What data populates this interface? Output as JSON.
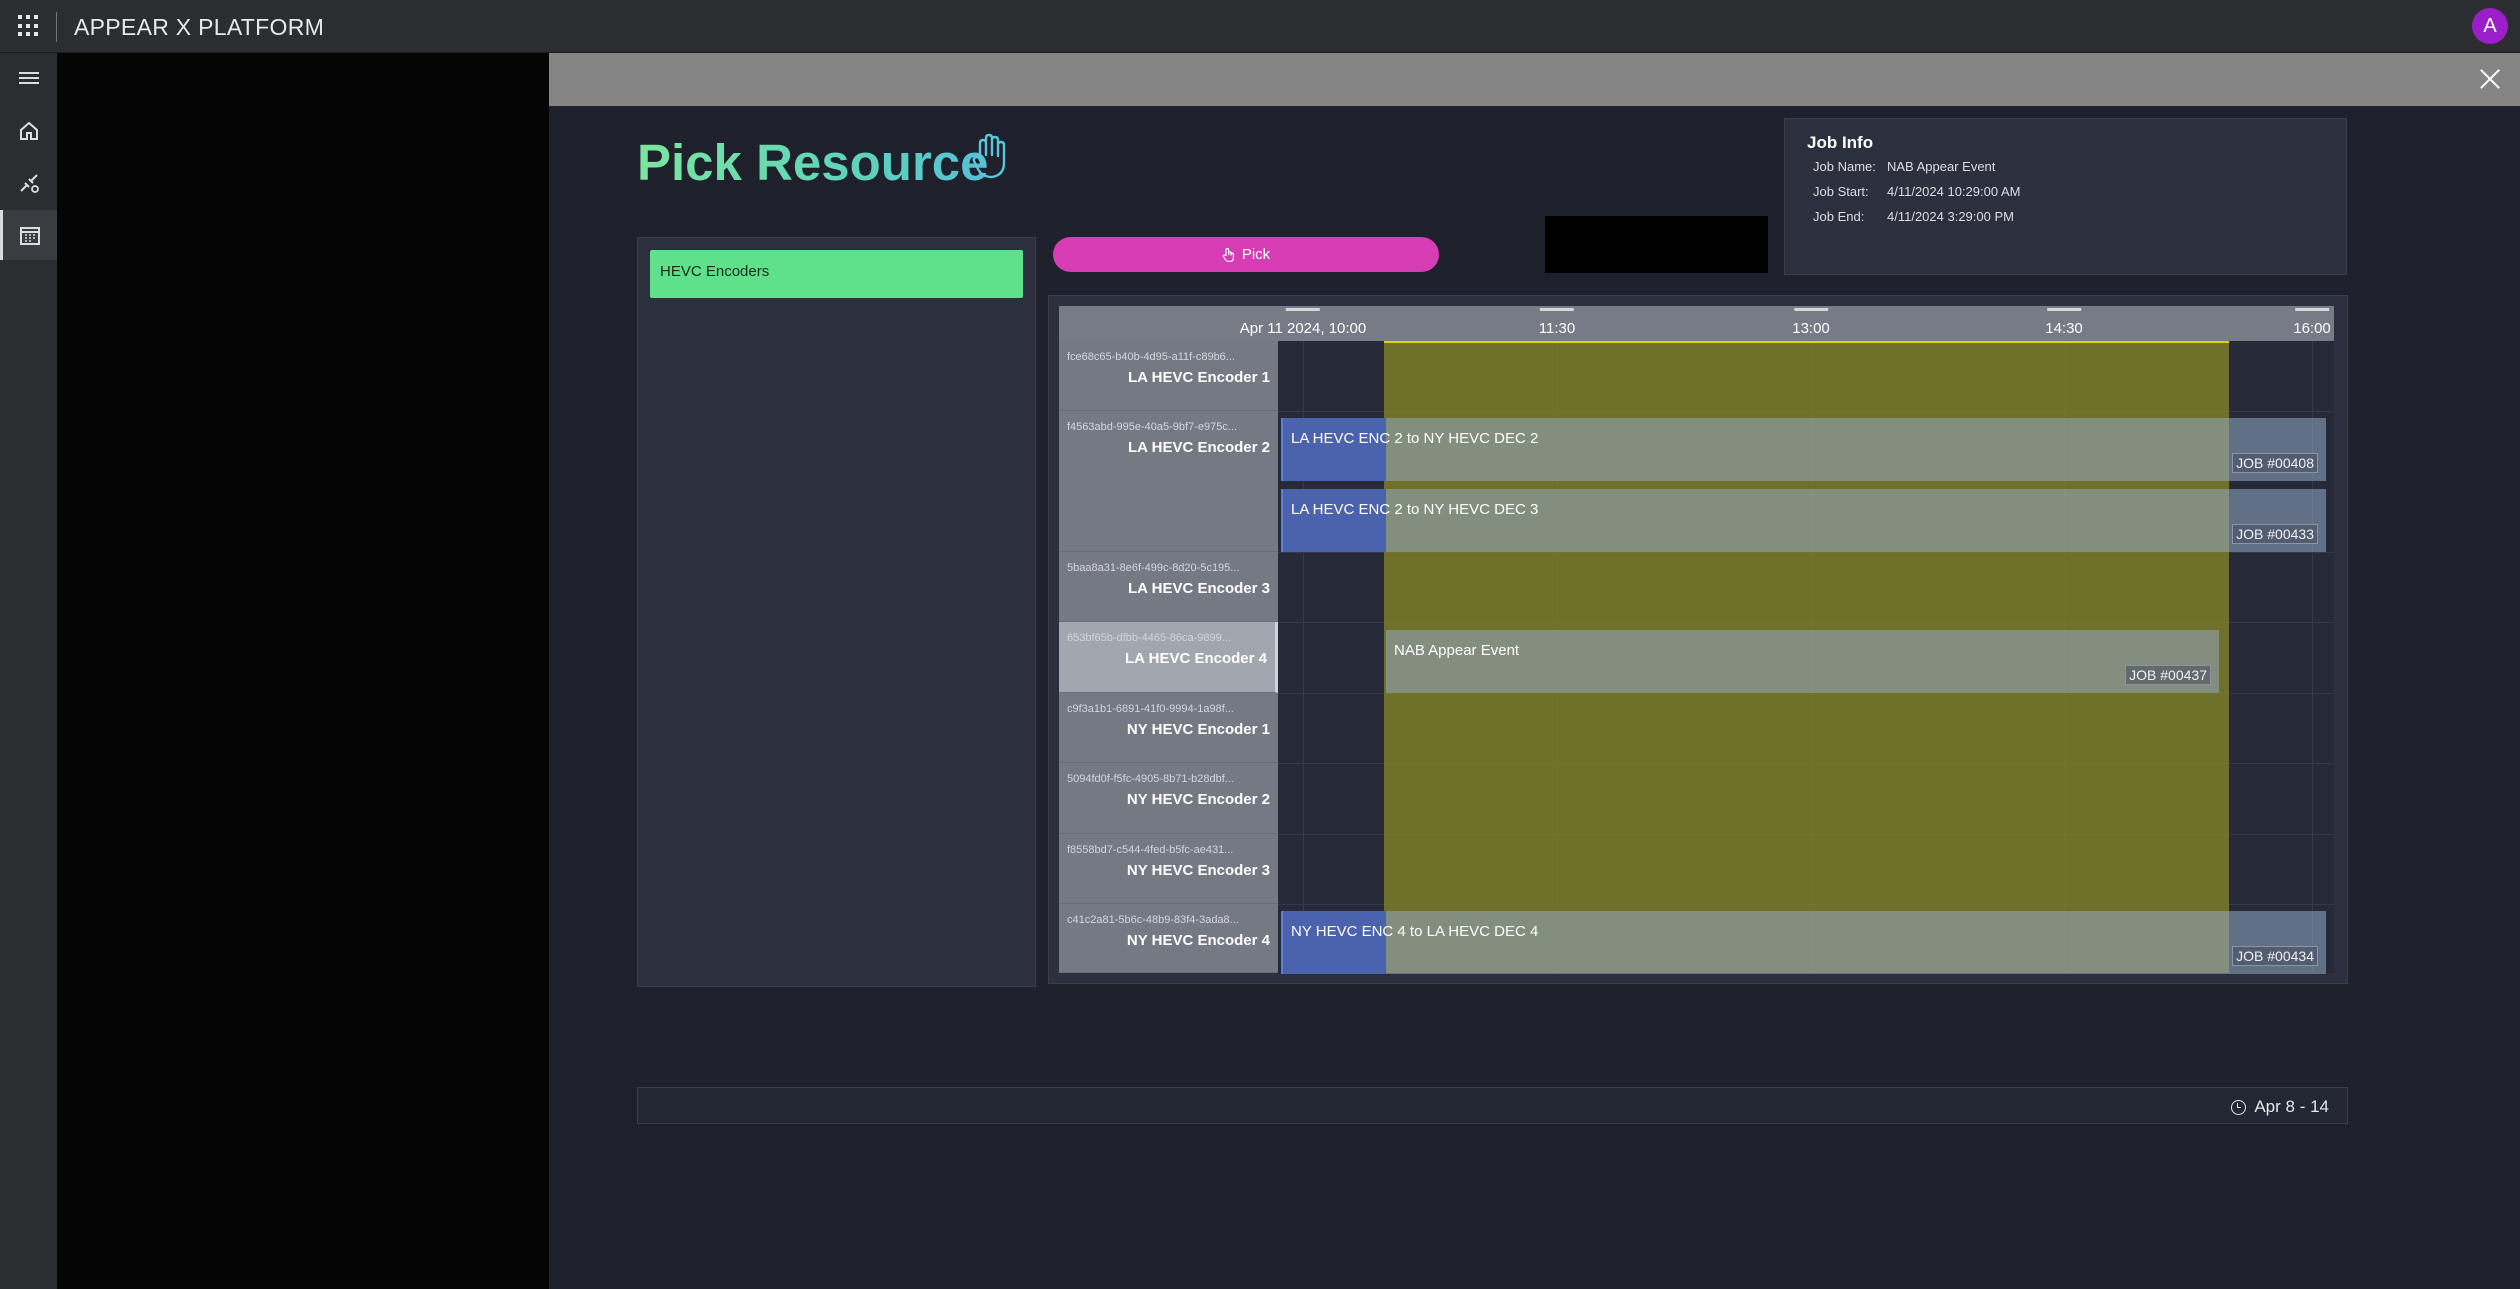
{
  "app": {
    "title": "APPEAR X PLATFORM",
    "avatar_letter": "A"
  },
  "nav": {
    "items": [
      "menu-icon",
      "home-icon",
      "connections-icon",
      "calendar-icon"
    ]
  },
  "modal": {
    "title": "Pick Resource"
  },
  "job_info": {
    "heading": "Job Info",
    "rows": [
      {
        "key": "Job Name:",
        "value": "NAB Appear Event"
      },
      {
        "key": "Job Start:",
        "value": "4/11/2024 10:29:00 AM"
      },
      {
        "key": "Job End:",
        "value": "4/11/2024 3:29:00 PM"
      }
    ]
  },
  "resources": {
    "selected": "HEVC Encoders"
  },
  "pick_button": {
    "label": "Pick"
  },
  "timeline": {
    "ticks": [
      "Apr 11 2024, 10:00",
      "11:30",
      "13:00",
      "14:30",
      "16:00"
    ],
    "rows": [
      {
        "id": "fce68c65-b40b-4d95-a11f-c89b6...",
        "name": "LA HEVC Encoder 1"
      },
      {
        "id": "f4563abd-995e-40a5-9bf7-e975c...",
        "name": "LA HEVC Encoder 2"
      },
      {
        "id": "5baa8a31-8e6f-499c-8d20-5c195...",
        "name": "LA HEVC Encoder 3"
      },
      {
        "id": "653bf65b-dfbb-4465-86ca-9899...",
        "name": "LA HEVC Encoder 4"
      },
      {
        "id": "c9f3a1b1-6891-41f0-9994-1a98f...",
        "name": "NY HEVC Encoder 1"
      },
      {
        "id": "5094fd0f-f5fc-4905-8b71-b28dbf...",
        "name": "NY HEVC Encoder 2"
      },
      {
        "id": "f8558bd7-c544-4fed-b5fc-ae431...",
        "name": "NY HEVC Encoder 3"
      },
      {
        "id": "c41c2a81-5b6c-48b9-83f4-3ada8...",
        "name": "NY HEVC Encoder 4"
      }
    ],
    "bars": [
      {
        "label": "LA HEVC ENC 2 to NY HEVC DEC 2",
        "job": "JOB #00408"
      },
      {
        "label": "LA HEVC ENC 2 to NY HEVC DEC 3",
        "job": "JOB #00433"
      },
      {
        "label": "NAB Appear Event",
        "job": "JOB #00437"
      },
      {
        "label": "NY HEVC ENC 4 to LA HEVC DEC 4",
        "job": "JOB #00434"
      }
    ]
  },
  "footer": {
    "date_range": "Apr 8 - 14"
  },
  "colors": {
    "accent_green": "#5fe08a",
    "pick_magenta": "#d63cb4",
    "window_olive": "#808026",
    "avatar": "#9b1fc9"
  }
}
